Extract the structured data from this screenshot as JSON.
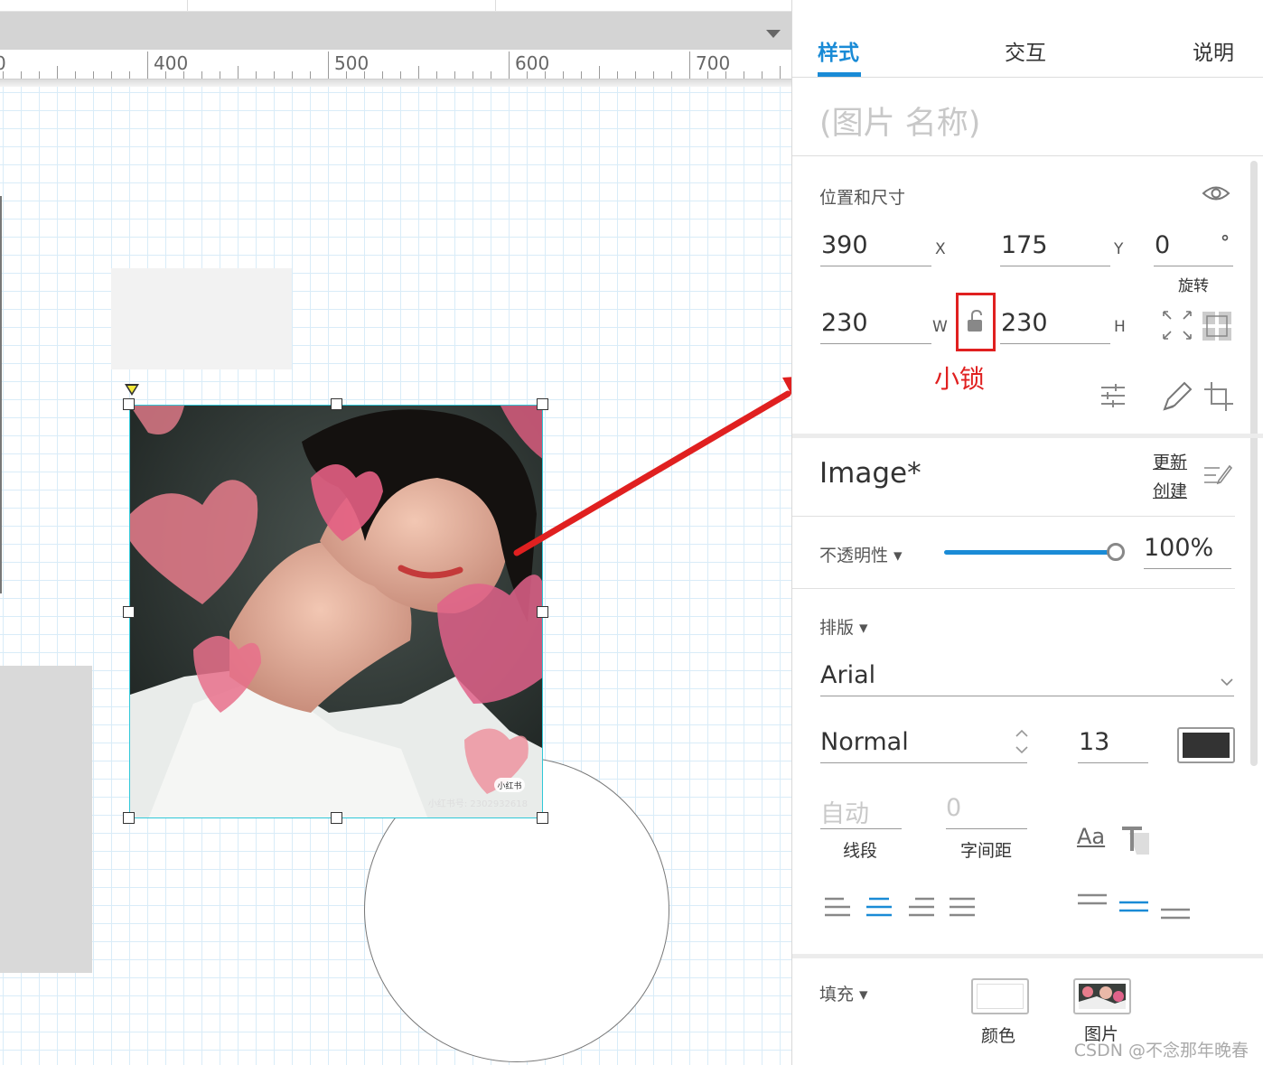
{
  "canvas": {
    "ruler_labels": [
      "0",
      "400",
      "500",
      "600",
      "700"
    ],
    "image_widget": {
      "photo_caption": "小红书号: 2302932618",
      "photo_badge": "小红书"
    }
  },
  "annotation": {
    "label": "小锁",
    "color": "#e02020"
  },
  "panel": {
    "tabs": [
      {
        "label": "样式",
        "active": true
      },
      {
        "label": "交互",
        "active": false
      },
      {
        "label": "说明",
        "active": false
      }
    ],
    "widget_name_placeholder": "(图片 名称)",
    "position_size": {
      "title": "位置和尺寸",
      "x": {
        "value": "390",
        "unit": "X"
      },
      "y": {
        "value": "175",
        "unit": "Y"
      },
      "rotation": {
        "value": "0",
        "unit": "°",
        "label": "旋转"
      },
      "w": {
        "value": "230",
        "unit": "W"
      },
      "h": {
        "value": "230",
        "unit": "H"
      }
    },
    "style": {
      "name": "Image*",
      "update_link": "更新",
      "create_link": "创建"
    },
    "opacity": {
      "label": "不透明性 ▾",
      "value": "100%",
      "level": 1.0
    },
    "typography": {
      "label": "排版 ▾",
      "font_family": "Arial",
      "font_style": "Normal",
      "font_size": "13",
      "text_color": "#333333",
      "line_spacing": {
        "value": "自动",
        "label": "线段"
      },
      "char_spacing": {
        "value": "0",
        "label": "字间距"
      },
      "case_icon_text": "Aa"
    },
    "fill": {
      "label": "填充 ▾",
      "color_label": "颜色",
      "image_label": "图片"
    },
    "accent_color": "#1a8bd6"
  },
  "watermark": "CSDN @不念那年晚春"
}
